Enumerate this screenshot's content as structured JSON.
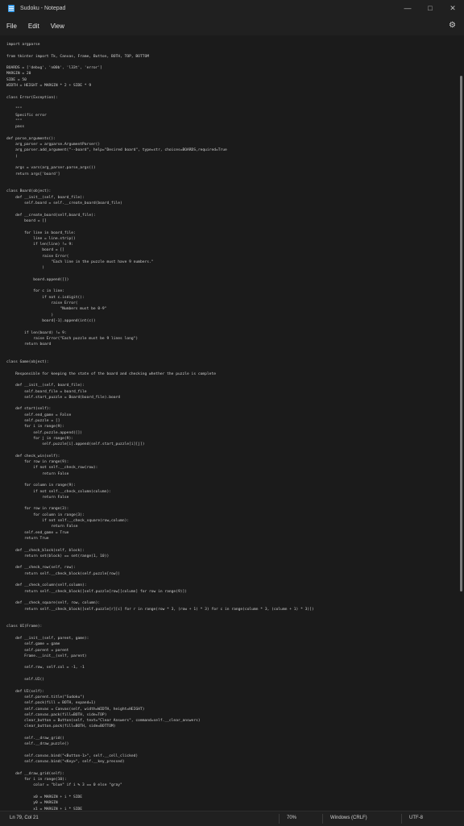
{
  "window": {
    "title": "Sudoku - Notepad",
    "controls": {
      "minimize": "—",
      "maximize": "□",
      "close": "✕"
    }
  },
  "menu": {
    "file": "File",
    "edit": "Edit",
    "view": "View"
  },
  "editor": {
    "code": "import argparse\n\nfrom tkinter import Tk, Canvas, Frame, Button, BOTH, TOP, BOTTOM\n\nBOARDS = ['debug', 'n00b', 'l33t', 'error']\nMARGIN = 20\nSIDE = 50\nWIDTH = HEIGHT = MARGIN * 2 + SIDE * 9\n\nclass Error(Exception):\n\n    \"\"\"\n    Specific error\n    \"\"\"\n    pass\n\ndef parse_arguments():\n    arg_parser = argparse.ArgumentParser()\n    arg_parser.add_argument(\"--board\", help=\"Desired board\", type=str, choices=BOARDS,required=True\n    )\n\n    args = vars(arg_parser.parse_args())\n    return args['board']\n\n\nclass Board(object):\n    def __init__(self, board_file):\n        self.board = self.__create_board(board_file)\n\n    def __create_board(self,board_file):\n        board = []\n\n        for line in board_file:\n            line = line.strip()\n            if len(line) != 9:\n                board = []\n                raise Error(\n                    \"Each line in the puzzle must have 9 numbers.\"\n                )\n\n            board.append([])\n\n            for c in line:\n                if not c.isdigit():\n                    raise Error(\n                        \"Numbers must be 0-9\"\n                    )\n                board[-1].append(int(c))\n\n        if len(board) != 9:\n            raise Error(\"Each puzzle must be 9 lines long\")\n        return board\n\n\nclass Game(object):\n\n    Responsible for keeping the state of the board and checking whether the puzzle is complete\n\n    def __init__(self, board_file):\n        self.board_file = board_file\n        self.start_puzzle = Board(board_file).board\n\n    def start(self):\n        self.end_game = False\n        self.puzzle = []\n        for i in range(9):\n            self.puzzle.append([])\n            for j in range(9):\n                self.puzzle[i].append(self.start_puzzle[i][j])\n\n    def check_win(self):\n        for row in range(9):\n            if not self.__check_row(row):\n                return False\n\n        for column in range(9):\n            if not self.__check_column(column):\n                return False\n\n        for row in range(3):\n            for column in range(3):\n                if not self.__check_square(row,column):\n                    return False\n        self.end_game = True\n        return True\n\n    def __check_block(self, block):\n        return set(block) == set(range(1, 10))\n\n    def __check_row(self, row):\n        return self.__check_block(self.puzzle[row])\n\n    def __check_column(self,column):\n        return self.__check_block([self.puzzle[row][column] for row in range(9)])\n\n    def __check_square(self, row, column):\n        return self.__check_block([self.puzzle[r][c] for r in range(row * 3, (row + 1) * 3) for c in range(column * 3, (column + 1) * 3)])\n\n\nclass UI(Frame):\n\n    def __init__(self, parent, game):\n        self.game = game\n        self.parent = parent\n        Frame.__init__(self, parent)\n\n        self.row, self.col = -1, -1\n\n        self.UI()\n\n    def UI(self):\n        self.parent.title(\"Sudoku\")\n        self.pack(fill = BOTH, expand=1)\n        self.canvas = Canvas(self, width=WIDTH, height=HEIGHT)\n        self.canvas.pack(fill=BOTH, side=TOP)\n        clear_button = Button(self, text=\"Clear Answers\", command=self.__clear_answers)\n        clear_button.pack(fill=BOTH, side=BOTTOM)\n\n        self.__draw_grid()\n        self.__draw_puzzle()\n\n        self.canvas.bind(\"<Button-1>\", self.__cell_clicked)\n        self.canvas.bind(\"<Key>\", self.__key_pressed)\n\n    def __draw_grid(self):\n        for i in range(10):\n            color = \"blue\" if i % 3 == 0 else \"gray\"\n\n            x0 = MARGIN + i * SIDE\n            y0 = MARGIN\n            x1 = MARGIN + i * SIDE"
  },
  "statusbar": {
    "position": "Ln 79, Col 21",
    "zoom": "70%",
    "line_ending": "Windows (CRLF)",
    "encoding": "UTF-8"
  }
}
